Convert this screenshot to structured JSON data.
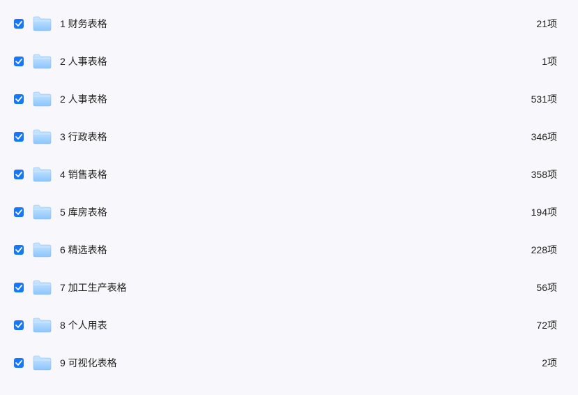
{
  "items": [
    {
      "label": "1 财务表格",
      "count": "21项"
    },
    {
      "label": "2 人事表格",
      "count": "1项"
    },
    {
      "label": "2 人事表格",
      "count": "531项"
    },
    {
      "label": "3 行政表格",
      "count": "346项"
    },
    {
      "label": "4 销售表格",
      "count": "358项"
    },
    {
      "label": "5 库房表格",
      "count": "194项"
    },
    {
      "label": "6 精选表格",
      "count": "228项"
    },
    {
      "label": "7 加工生产表格",
      "count": "56项"
    },
    {
      "label": "8 个人用表",
      "count": "72项"
    },
    {
      "label": "9 可视化表格",
      "count": "2项"
    }
  ]
}
